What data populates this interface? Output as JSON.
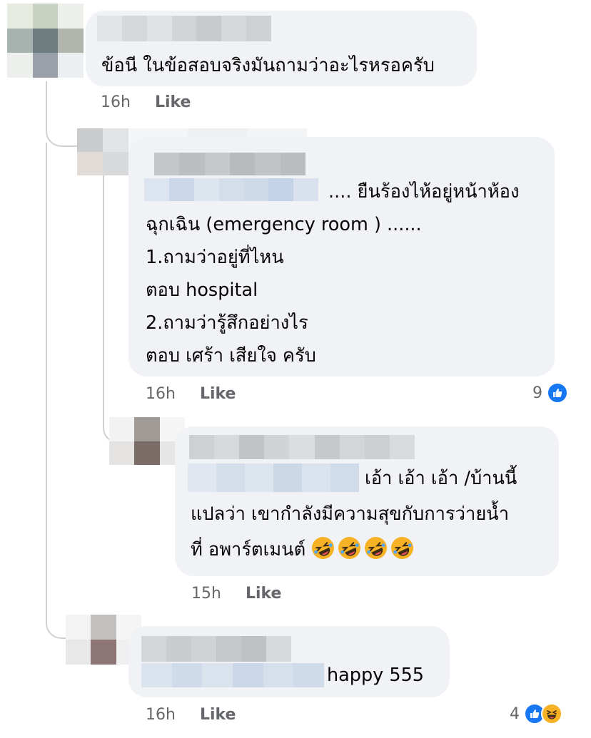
{
  "comments": [
    {
      "text_lines": [
        "ข้อนี ในข้อสอบจริงมันถามว่าอะไรหรอครับ"
      ],
      "time": "16h",
      "like_label": "Like"
    },
    {
      "text_lines": [
        ".... ยืนร้องไห้อยู่หน้าห้อง",
        "ฉุกเฉิน (emergency room ) ......",
        "1.ถามว่าอยู่ที่ไหน",
        "ตอบ hospital",
        "2.ถามว่ารู้สึกอย่างไร",
        "ตอบ เศร้า เสียใจ ครับ"
      ],
      "time": "16h",
      "like_label": "Like",
      "reaction_count": "9",
      "reactions": [
        "like-icon"
      ]
    },
    {
      "text_lines": [
        "เอ้า เอ้า เอ้า /บ้านนี้",
        "แปลว่า เขากำลังมีความสุขกับการว่ายน้ำ",
        "ที่ อพาร์ตเมนต์"
      ],
      "emojis": [
        "rolling-on-floor-laughing-emoji",
        "rolling-on-floor-laughing-emoji",
        "rolling-on-floor-laughing-emoji",
        "rolling-on-floor-laughing-emoji"
      ],
      "time": "15h",
      "like_label": "Like"
    },
    {
      "text_lines": [
        "happy 555"
      ],
      "time": "16h",
      "like_label": "Like",
      "reaction_count": "4",
      "reactions": [
        "like-icon",
        "haha-icon"
      ]
    }
  ],
  "colors": {
    "bubble": "#f0f2f5",
    "meta_text": "#65676b",
    "like_blue": "#1877f2",
    "haha_yellow": "#f7b125",
    "thread_line": "#ced0d4"
  }
}
